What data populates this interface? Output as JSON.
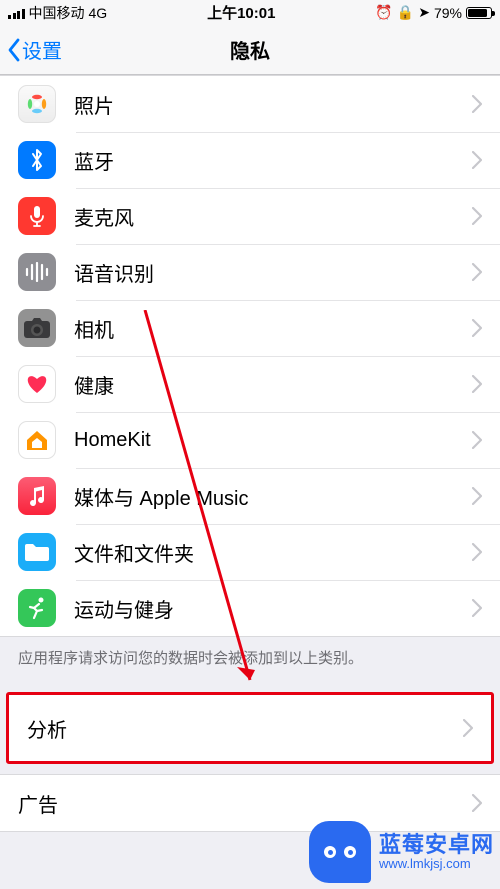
{
  "status": {
    "carrier": "中国移动",
    "network": "4G",
    "time": "上午10:01",
    "battery_pct": "79%",
    "icons": [
      "alarm",
      "lock",
      "location"
    ]
  },
  "nav": {
    "back_label": "设置",
    "title": "隐私"
  },
  "group1": [
    {
      "key": "photos",
      "label": "照片",
      "icon": "photos-icon"
    },
    {
      "key": "bluetooth",
      "label": "蓝牙",
      "icon": "bluetooth-icon"
    },
    {
      "key": "mic",
      "label": "麦克风",
      "icon": "microphone-icon"
    },
    {
      "key": "speech",
      "label": "语音识别",
      "icon": "waveform-icon"
    },
    {
      "key": "camera",
      "label": "相机",
      "icon": "camera-icon"
    },
    {
      "key": "health",
      "label": "健康",
      "icon": "heart-icon"
    },
    {
      "key": "homekit",
      "label": "HomeKit",
      "icon": "home-icon"
    },
    {
      "key": "music",
      "label": "媒体与 Apple Music",
      "icon": "music-icon"
    },
    {
      "key": "files",
      "label": "文件和文件夹",
      "icon": "folder-icon"
    },
    {
      "key": "motion",
      "label": "运动与健身",
      "icon": "running-icon"
    }
  ],
  "group1_footer": "应用程序请求访问您的数据时会被添加到以上类别。",
  "group2": [
    {
      "key": "analytics",
      "label": "分析",
      "highlighted": true
    },
    {
      "key": "ads",
      "label": "广告"
    }
  ],
  "annotation": {
    "type": "arrow",
    "color": "#e60012"
  },
  "watermark": {
    "title": "蓝莓安卓网",
    "url": "www.lmkjsj.com"
  }
}
